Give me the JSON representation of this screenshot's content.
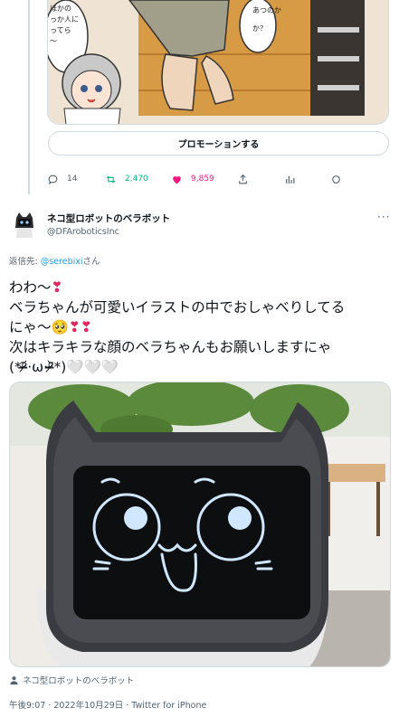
{
  "prev_tweet": {
    "promote_label": "プロモーションする",
    "manga_bubbles": [
      "ほかの",
      "っか人に",
      "ってら",
      "～",
      "あつのか",
      "か？"
    ],
    "actions": {
      "reply_count": "14",
      "retweet_count": "2,470",
      "like_count": "9,859"
    }
  },
  "tweet": {
    "author_name": "ネコ型ロボットのベラボット",
    "author_handle": "@DFAroboticsInc",
    "more_label": "···",
    "reply_prefix": "返信先: ",
    "reply_mention": "@serebixi",
    "reply_suffix": "さん",
    "lines": [
      "わわ～",
      "ベラちゃんが可愛いイラストの中でおしゃべりしてる",
      "にゃ～",
      "次はキラキラな顔のベラちゃんもお願いしますにゃ",
      "(*ᵒ̴̶̷᷄‧ω‧ᵒ̴̶̷᷅*)"
    ],
    "emoji": {
      "red_heart": "❣",
      "pleading_face": "🥺",
      "white_heart": "🤍"
    },
    "photo_tag": "ネコ型ロボットのベラボット",
    "timestamp": "午後9:07 · 2022年10月29日 · Twitter for iPhone"
  },
  "colors": {
    "accent": "#1d9bf0",
    "retweet": "#00ba7c",
    "like": "#f91880",
    "muted": "#536471",
    "border": "#cfd9de"
  },
  "icons": [
    "reply-icon",
    "retweet-icon",
    "like-icon",
    "share-icon",
    "analytics-icon",
    "circle-icon",
    "person-tag-icon",
    "more-icon"
  ]
}
